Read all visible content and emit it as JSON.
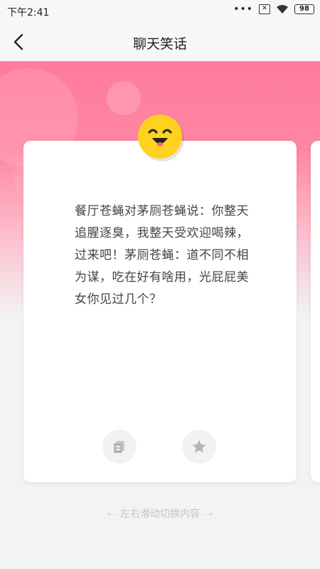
{
  "status": {
    "time": "下午2:41",
    "battery": "98",
    "sim_icon": "x-box-icon",
    "wifi_icon": "wifi-icon"
  },
  "nav": {
    "title": "聊天笑话",
    "back_icon": "chevron-left-icon"
  },
  "card": {
    "text": "餐厅苍蝇对茅厕苍蝇说：你整天追腥逐臭，我整天受欢迎喝辣，过来吧！茅厕苍蝇：道不同不相为谋，吃在好有啥用，光屁屁美女你见过几个？",
    "actions": [
      {
        "name": "copy",
        "icon": "copy-icon"
      },
      {
        "name": "favorite",
        "icon": "star-icon"
      }
    ]
  },
  "hint": {
    "text": "左右滑动切换内容",
    "left_arrow": "←·",
    "right_arrow": "·→"
  },
  "colors": {
    "header_pink": "#ff7b9b",
    "emoji_yellow": "#ffd21f",
    "text": "#444444",
    "hint_gray": "#c4c4c4"
  }
}
